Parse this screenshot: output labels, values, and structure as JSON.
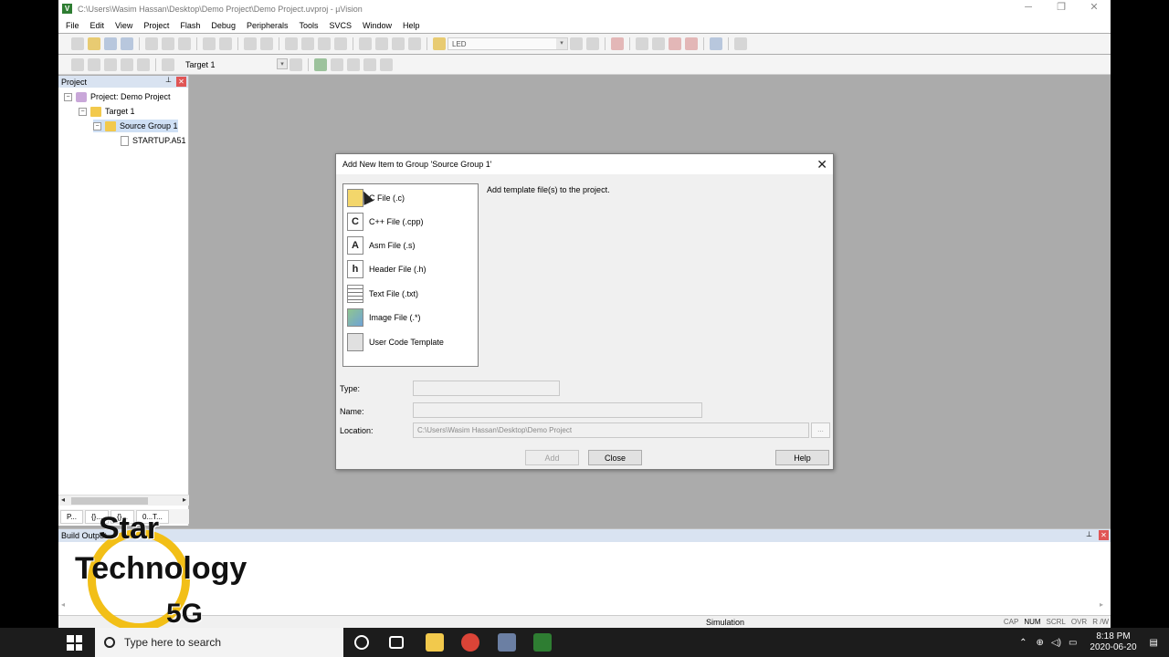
{
  "window": {
    "title": "C:\\Users\\Wasim Hassan\\Desktop\\Demo Project\\Demo Project.uvproj - µVision",
    "icon_label": "V"
  },
  "menu": [
    "File",
    "Edit",
    "View",
    "Project",
    "Flash",
    "Debug",
    "Peripherals",
    "Tools",
    "SVCS",
    "Window",
    "Help"
  ],
  "toolbar": {
    "find_combo": "LED",
    "target_combo": "Target 1"
  },
  "project_panel": {
    "title": "Project",
    "tree": {
      "project": "Project: Demo Project",
      "target": "Target 1",
      "group": "Source Group 1",
      "file": "STARTUP.A51"
    },
    "tabs": [
      "P...",
      "{}...",
      "{}...",
      "0...T..."
    ]
  },
  "build_panel": {
    "title": "Build Output"
  },
  "dialog": {
    "title": "Add New Item to Group 'Source Group 1'",
    "description": "Add template file(s) to the project.",
    "items": [
      {
        "label": "C File (.c)",
        "glyph": "",
        "icon": "c-file-icon"
      },
      {
        "label": "C++ File (.cpp)",
        "glyph": "C",
        "icon": "cpp-file-icon"
      },
      {
        "label": "Asm File (.s)",
        "glyph": "A",
        "icon": "asm-file-icon"
      },
      {
        "label": "Header File (.h)",
        "glyph": "h",
        "icon": "header-file-icon"
      },
      {
        "label": "Text File (.txt)",
        "glyph": "",
        "icon": "text-file-icon"
      },
      {
        "label": "Image File (.*)",
        "glyph": "",
        "icon": "image-file-icon"
      },
      {
        "label": "User Code Template",
        "glyph": "",
        "icon": "template-icon"
      }
    ],
    "type_label": "Type:",
    "name_label": "Name:",
    "location_label": "Location:",
    "type_value": "",
    "name_value": "",
    "location_value": "C:\\Users\\Wasim Hassan\\Desktop\\Demo Project",
    "browse_label": "...",
    "add_label": "Add",
    "close_label": "Close",
    "help_label": "Help"
  },
  "statusbar": {
    "mode": "Simulation",
    "keys": [
      "CAP",
      "NUM",
      "SCRL",
      "OVR",
      "R /W"
    ]
  },
  "watermark": {
    "line1": "Star",
    "line2": "Technology",
    "line3": "5G"
  },
  "taskbar": {
    "search_placeholder": "Type here to search",
    "time": "8:18 PM",
    "date": "2020-06-20"
  }
}
